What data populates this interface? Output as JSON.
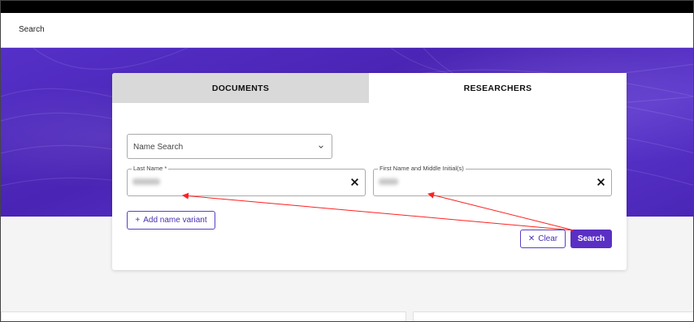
{
  "header": {
    "title": "Search"
  },
  "tabs": [
    {
      "label": "DOCUMENTS",
      "active": false
    },
    {
      "label": "RESEARCHERS",
      "active": true
    }
  ],
  "form": {
    "search_type": {
      "selected": "Name Search"
    },
    "last_name": {
      "label": "Last Name *"
    },
    "first_name": {
      "label": "First Name and Middle Initial(s)"
    },
    "add_variant_label": "Add name variant",
    "clear_label": "Clear",
    "search_label": "Search"
  },
  "colors": {
    "accent": "#5a2fc4",
    "hero": "#4a24b4",
    "annotation_arrow": "#ff0000"
  }
}
